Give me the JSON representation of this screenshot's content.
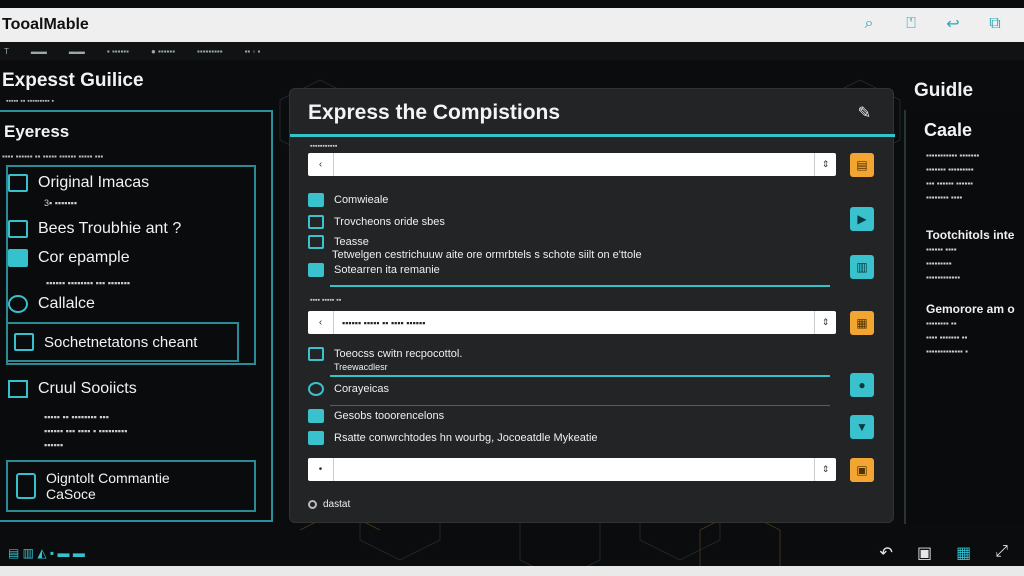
{
  "app": {
    "title": "TooalMable"
  },
  "titlebar_icons": [
    {
      "name": "search-icon",
      "glyph": "⌕"
    },
    {
      "name": "bookmark-icon",
      "glyph": "⍞"
    },
    {
      "name": "share-icon",
      "glyph": "↩"
    },
    {
      "name": "window-icon",
      "glyph": "⧉"
    }
  ],
  "toolbar": {
    "items": [
      "T",
      "▬▬",
      "▬▬",
      "▪ ▪▪▪▪▪▪",
      "● ▪▪▪▪▪▪",
      "▪▪▪▪▪▪▪▪▪",
      "▪▪ ◦ ▪"
    ]
  },
  "left": {
    "heading": "Expesst Guilice",
    "subheading": "▪▪▪▪▪ ▪▪ ▪▪▪▪▪▪▪▪▪ ▪",
    "panel_title": "Eyeress",
    "panel_small": "▪▪▪▪ ▪▪▪▪▪▪   ▪▪ ▪▪▪▪▪ ▪▪▪▪▪▪ ▪▪▪▪▪ ▪▪▪",
    "items": [
      {
        "label": "Original Imacas",
        "note": "3▪ ▪▪▪▪▪▪▪"
      },
      {
        "label": "Bees Troubhie ant ?",
        "note": ""
      },
      {
        "label": "Cor epample",
        "note": "▪▪▪▪▪▪ ▪▪▪▪▪▪▪▪ ▪▪▪ ▪▪▪▪▪▪▪"
      },
      {
        "label": "Callalce",
        "note": ""
      }
    ],
    "selected_item": "Sochetnetatons cheant",
    "section_title": "Cruul Sooiicts",
    "section_note_1": "▪▪▪▪▪ ▪▪ ▪▪▪▪▪▪▪▪ ▪▪▪",
    "section_note_2": "▪▪▪▪▪▪ ▪▪▪ ▪▪▪▪ ▪ ▪▪▪▪▪▪▪▪▪",
    "section_note_3": "▪▪▪▪▪▪",
    "footer_item": "Oigntolt Commantie\nCaSoce"
  },
  "card": {
    "title": "Express the Compistions",
    "edit_glyph": "✎",
    "fields": [
      {
        "label": "▪▪▪▪▪▪▪▪▪▪▪",
        "value": "",
        "lead": "‹"
      },
      {
        "label": "▪▪▪▪ ▪▪▪▪▪ ▪▪",
        "value": "▪▪▪▪▪▪ ▪▪▪▪▪ ▪▪ ▪▪▪▪ ▪▪▪▪▪▪",
        "lead": "‹"
      },
      {
        "label": "",
        "value": "",
        "lead": "•"
      }
    ],
    "rows_group1": [
      {
        "text": "Comwieale",
        "style": "fill"
      },
      {
        "text": "Trovcheons oride sbes",
        "style": "outline"
      },
      {
        "text": "Teasse",
        "style": "outline"
      },
      {
        "text": "Tetwelgen cestrichuuw aite ore ormrbtels s schote siilt on e'ttole",
        "style": "none"
      },
      {
        "text": "Sotearren ita remanie",
        "style": "fill"
      }
    ],
    "rows_group2": [
      {
        "text": "Toeocss cwitn recpocottol.",
        "style": "outline"
      },
      {
        "text": "Treewacdlesr",
        "style": "none"
      },
      {
        "text": "Corayeicas",
        "style": "outline"
      }
    ],
    "rows_group3": [
      {
        "text": "Gesobs tooorencelons",
        "style": "fill"
      },
      {
        "text": "Rsatte conwrchtodes hn wourbg, Jocoeatdle Mykeatie",
        "style": "fill"
      }
    ],
    "side_buttons": [
      {
        "name": "orange-action-1",
        "glyph": "▤",
        "color": "orange"
      },
      {
        "name": "teal-action-1",
        "glyph": "▶",
        "color": "teal"
      },
      {
        "name": "teal-action-2",
        "glyph": "▥",
        "color": "teal"
      },
      {
        "name": "orange-action-2",
        "glyph": "▦",
        "color": "orange"
      },
      {
        "name": "teal-action-3",
        "glyph": "●",
        "color": "teal"
      },
      {
        "name": "teal-action-4",
        "glyph": "▼",
        "color": "teal"
      },
      {
        "name": "orange-action-3",
        "glyph": "▣",
        "color": "orange"
      }
    ],
    "status": "dastat"
  },
  "right": {
    "heading": "Guidle",
    "panel_title": "Caale",
    "text_1": [
      "▪▪▪▪▪▪▪▪▪▪▪ ▪▪▪▪▪▪▪",
      "▪▪▪▪▪▪▪ ▪▪▪▪▪▪▪▪▪",
      "▪▪▪ ▪▪▪▪▪▪ ▪▪▪▪▪▪",
      "▪▪▪▪▪▪▪▪ ▪▪▪▪"
    ],
    "sub_1": "Tootchitols inte",
    "text_2": [
      "▪▪▪▪▪▪ ▪▪▪▪",
      "▪▪▪▪▪▪▪▪▪",
      "▪▪▪▪▪▪▪▪▪▪▪▪"
    ],
    "sub_2": "Gemorore am o",
    "text_3": [
      "▪▪▪▪▪▪▪▪ ▪▪",
      "▪▪▪▪ ▪▪▪▪▪▪▪ ▪▪",
      "▪▪▪▪▪▪▪▪▪▪▪▪▪ ▪"
    ]
  },
  "bottombar": {
    "left_glyphs": "▤ ▥ ◭ ▪ ▬ ▬",
    "right_icons": [
      {
        "name": "undo-icon",
        "glyph": "↶"
      },
      {
        "name": "image-icon",
        "glyph": "▣"
      },
      {
        "name": "grid-icon",
        "glyph": "▦"
      },
      {
        "name": "expand-icon",
        "glyph": "⤢"
      }
    ]
  },
  "colors": {
    "accent": "#34c3c8",
    "orange": "#f2a531",
    "background": "#0b0c0d",
    "card": "#232426"
  }
}
